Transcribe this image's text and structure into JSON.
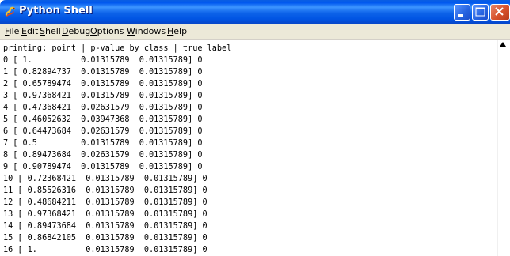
{
  "window": {
    "title": "Python Shell",
    "icon": "python-snake-icon",
    "controls": [
      "minimize-icon",
      "maximize-icon",
      "close-icon"
    ]
  },
  "menu": {
    "items": [
      {
        "label": "File",
        "underline": "F",
        "rest": "ile"
      },
      {
        "label": "Edit",
        "underline": "E",
        "rest": "dit"
      },
      {
        "label": "Shell",
        "underline": "S",
        "rest": "hell"
      },
      {
        "label": "Debug",
        "underline": "D",
        "rest": "ebug"
      },
      {
        "label": "Options",
        "underline": "O",
        "rest": "ptions"
      },
      {
        "label": "Windows",
        "underline": "W",
        "rest": "indows"
      },
      {
        "label": "Help",
        "underline": "H",
        "rest": "elp"
      }
    ]
  },
  "shell": {
    "lines": [
      "printing: point | p-value by class | true label",
      "0 [ 1.          0.01315789  0.01315789] 0",
      "1 [ 0.82894737  0.01315789  0.01315789] 0",
      "2 [ 0.65789474  0.01315789  0.01315789] 0",
      "3 [ 0.97368421  0.01315789  0.01315789] 0",
      "4 [ 0.47368421  0.02631579  0.01315789] 0",
      "5 [ 0.46052632  0.03947368  0.01315789] 0",
      "6 [ 0.64473684  0.02631579  0.01315789] 0",
      "7 [ 0.5         0.01315789  0.01315789] 0",
      "8 [ 0.89473684  0.02631579  0.01315789] 0",
      "9 [ 0.90789474  0.01315789  0.01315789] 0",
      "10 [ 0.72368421  0.01315789  0.01315789] 0",
      "11 [ 0.85526316  0.01315789  0.01315789] 0",
      "12 [ 0.48684211  0.01315789  0.01315789] 0",
      "13 [ 0.97368421  0.01315789  0.01315789] 0",
      "14 [ 0.89473684  0.01315789  0.01315789] 0",
      "15 [ 0.86842105  0.01315789  0.01315789] 0",
      "16 [ 1.          0.01315789  0.01315789] 0"
    ]
  },
  "colors": {
    "titlebar": "#0054e3",
    "menubar": "#ece9d8",
    "shell_background": "#ffffff",
    "text": "#000000"
  }
}
